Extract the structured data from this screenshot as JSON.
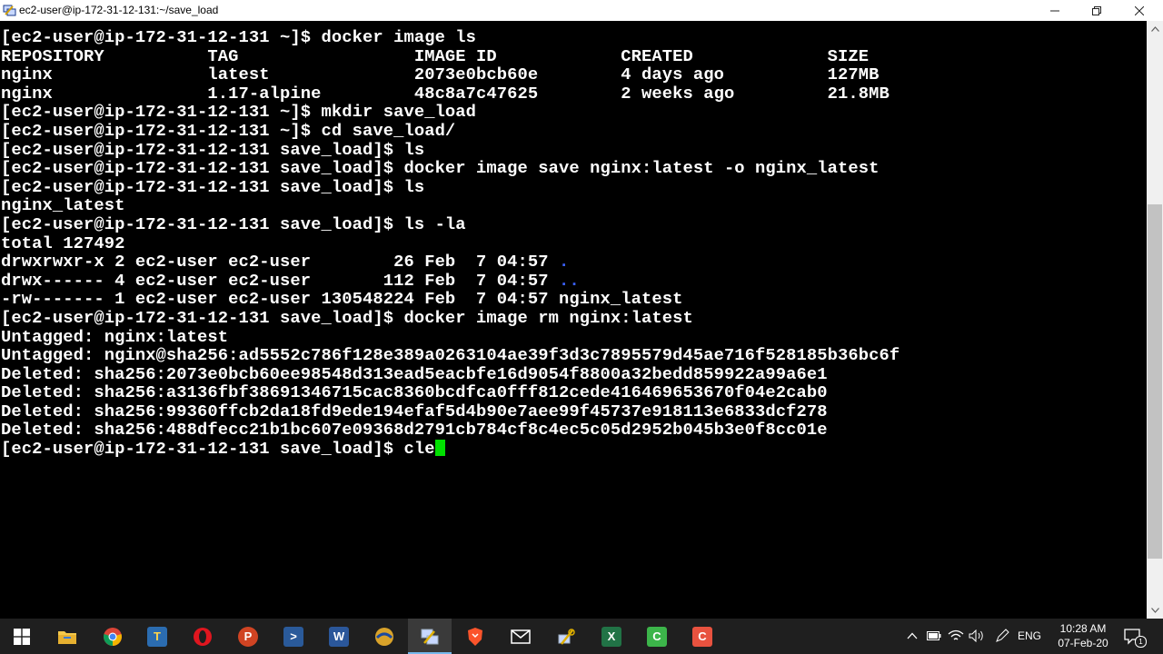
{
  "window": {
    "title": "ec2-user@ip-172-31-12-131:~/save_load"
  },
  "terminal": {
    "lines": [
      "[ec2-user@ip-172-31-12-131 ~]$ docker image ls",
      "REPOSITORY          TAG                 IMAGE ID            CREATED             SIZE",
      "nginx               latest              2073e0bcb60e        4 days ago          127MB",
      "nginx               1.17-alpine         48c8a7c47625        2 weeks ago         21.8MB",
      "[ec2-user@ip-172-31-12-131 ~]$ mkdir save_load",
      "[ec2-user@ip-172-31-12-131 ~]$ cd save_load/",
      "[ec2-user@ip-172-31-12-131 save_load]$ ls",
      "[ec2-user@ip-172-31-12-131 save_load]$ docker image save nginx:latest -o nginx_latest",
      "[ec2-user@ip-172-31-12-131 save_load]$ ls",
      "nginx_latest",
      "[ec2-user@ip-172-31-12-131 save_load]$ ls -la",
      "total 127492",
      "drwxrwxr-x 2 ec2-user ec2-user        26 Feb  7 04:57 ",
      "drwx------ 4 ec2-user ec2-user       112 Feb  7 04:57 ",
      "-rw------- 1 ec2-user ec2-user 130548224 Feb  7 04:57 nginx_latest",
      "[ec2-user@ip-172-31-12-131 save_load]$ docker image rm nginx:latest",
      "Untagged: nginx:latest",
      "Untagged: nginx@sha256:ad5552c786f128e389a0263104ae39f3d3c7895579d45ae716f528185b36bc6f",
      "Deleted: sha256:2073e0bcb60ee98548d313ead5eacbfe16d9054f8800a32bedd859922a99a6e1",
      "Deleted: sha256:a3136fbf38691346715cac8360bcdfca0fff812cede416469653670f04e2cab0",
      "Deleted: sha256:99360ffcb2da18fd9ede194efaf5d4b90e7aee99f45737e918113e6833dcf278",
      "Deleted: sha256:488dfecc21b1bc607e09368d2791cb784cf8c4ec5c05d2952b045b3e0f8cc01e",
      "[ec2-user@ip-172-31-12-131 save_load]$ cle"
    ],
    "dir_current": ".",
    "dir_parent": "..",
    "cursor_color": "#00e000",
    "dir_color": "#3b62ff"
  },
  "taskbar": {
    "apps": [
      {
        "name": "windows-start-icon",
        "label": ""
      },
      {
        "name": "file-explorer-icon",
        "label": ""
      },
      {
        "name": "chrome-icon",
        "label": ""
      },
      {
        "name": "app-icon-3",
        "label": ""
      },
      {
        "name": "opera-icon",
        "label": ""
      },
      {
        "name": "powerpoint-icon",
        "label": "P"
      },
      {
        "name": "powershell-icon",
        "label": ">"
      },
      {
        "name": "word-icon",
        "label": "W"
      },
      {
        "name": "app-icon-8",
        "label": ""
      },
      {
        "name": "putty-icon",
        "label": ""
      },
      {
        "name": "brave-icon",
        "label": ""
      },
      {
        "name": "mail-icon",
        "label": ""
      },
      {
        "name": "app-icon-12",
        "label": ""
      },
      {
        "name": "excel-icon",
        "label": "X"
      },
      {
        "name": "camtasia-green-icon",
        "label": "C"
      },
      {
        "name": "camtasia-red-icon",
        "label": "C"
      }
    ],
    "tray": {
      "language": "ENG",
      "time": "10:28 AM",
      "date": "07-Feb-20",
      "notification_count": "1"
    }
  }
}
